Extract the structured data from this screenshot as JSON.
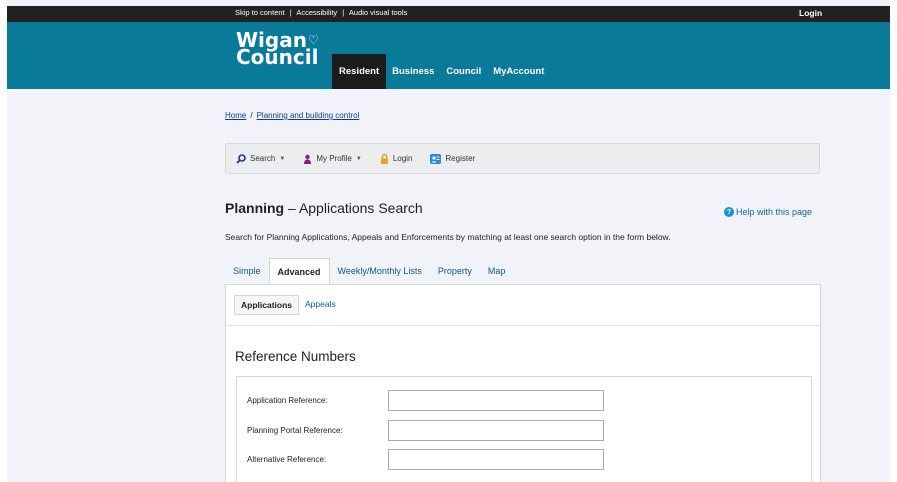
{
  "utility_bar": {
    "links": [
      "Skip to content",
      "Accessibility",
      "Audio visual tools"
    ],
    "separator": "|",
    "login_label": "Login"
  },
  "header": {
    "logo_line1": "Wigan",
    "logo_line2": "Council",
    "nav": [
      "Resident",
      "Business",
      "Council",
      "MyAccount"
    ],
    "active_nav": "Resident",
    "brand_color": "#0a7a9a"
  },
  "breadcrumb": {
    "home": "Home",
    "separator": "/",
    "current": "Planning and building control"
  },
  "toolbar": {
    "search": "Search",
    "profile": "My Profile",
    "login": "Login",
    "register": "Register",
    "icons": [
      "search-icon",
      "profile-icon",
      "lock-icon",
      "register-icon"
    ]
  },
  "page": {
    "title_bold": "Planning",
    "title_dash": "–",
    "title_rest": "Applications Search",
    "help": "Help with this page",
    "intro": "Search for Planning Applications, Appeals and Enforcements by matching at least one search option in the form below."
  },
  "tabs": {
    "items": [
      "Simple",
      "Advanced",
      "Weekly/Monthly Lists",
      "Property",
      "Map"
    ],
    "active": "Advanced"
  },
  "subtabs": {
    "items": [
      "Applications",
      "Appeals"
    ],
    "active": "Applications"
  },
  "reference_section": {
    "title": "Reference Numbers",
    "fields": [
      {
        "label": "Application Reference:",
        "value": ""
      },
      {
        "label": "Planning Portal Reference:",
        "value": ""
      },
      {
        "label": "Alternative Reference:",
        "value": ""
      }
    ]
  }
}
